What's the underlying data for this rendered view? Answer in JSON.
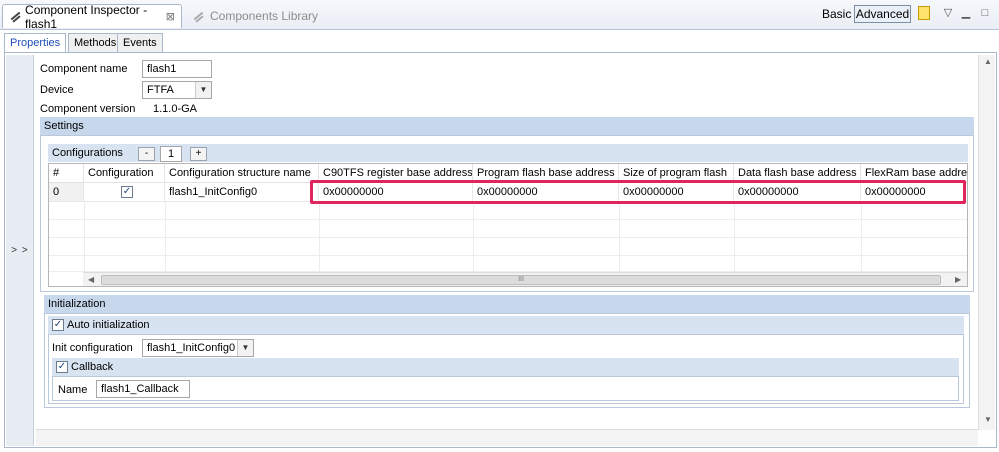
{
  "header": {
    "active_tab": "Component Inspector - flash1",
    "inactive_tab": "Components Library",
    "mode_basic": "Basic",
    "mode_advanced": "Advanced"
  },
  "subtabs": [
    "Properties",
    "Methods",
    "Events"
  ],
  "gutter_label": "> >",
  "properties": {
    "component_name_label": "Component name",
    "component_name_value": "flash1",
    "device_label": "Device",
    "device_value": "FTFA",
    "version_label": "Component version",
    "version_value": "1.1.0-GA"
  },
  "settings": {
    "title": "Settings",
    "configurations_label": "Configurations",
    "minus": "-",
    "count": "1",
    "plus": "+",
    "columns": [
      "#",
      "Configuration",
      "Configuration structure name",
      "C90TFS register base address",
      "Program flash base address",
      "Size of program flash",
      "Data flash base address",
      "FlexRam base addre"
    ],
    "rows": [
      {
        "index": "0",
        "checked": "✓",
        "struct": "flash1_InitConfig0",
        "reg_base": "0x00000000",
        "pflash_base": "0x00000000",
        "pflash_size": "0x00000000",
        "dflash_base": "0x00000000",
        "flexram_base": "0x00000000"
      }
    ],
    "hscroll_grip": "III"
  },
  "initialization": {
    "title": "Initialization",
    "auto_init_label": "Auto initialization",
    "auto_init_checked": "✓",
    "init_config_label": "Init configuration",
    "init_config_value": "flash1_InitConfig0",
    "callback_label": "Callback",
    "callback_checked": "✓",
    "name_label": "Name",
    "name_value": "flash1_Callback"
  },
  "icons": {
    "inspector": "component-inspector-icon",
    "library": "components-library-icon",
    "minimize": "minimize-icon",
    "maximize": "maximize-icon"
  },
  "colors": {
    "highlight": "#e0245e",
    "section_bar": "#c7d8ec",
    "active_tab_text": "#1f4fb8"
  }
}
